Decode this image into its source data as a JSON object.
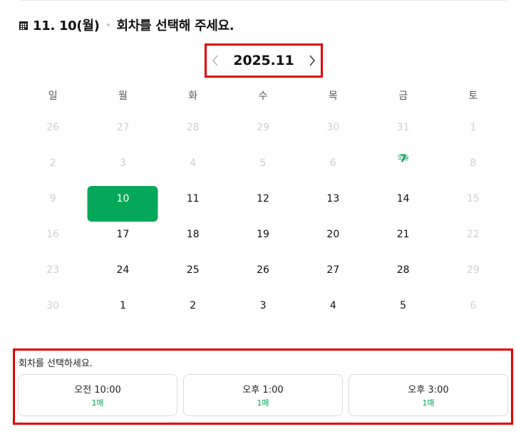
{
  "header": {
    "date": "11. 10(월)",
    "message": "회차를 선택해 주세요."
  },
  "calendar": {
    "month_label": "2025.11",
    "weekdays": [
      "일",
      "월",
      "화",
      "수",
      "목",
      "금",
      "토"
    ],
    "today_label": "오늘",
    "weeks": [
      [
        {
          "d": "26",
          "s": "muted"
        },
        {
          "d": "27",
          "s": "muted"
        },
        {
          "d": "28",
          "s": "muted"
        },
        {
          "d": "29",
          "s": "muted"
        },
        {
          "d": "30",
          "s": "muted"
        },
        {
          "d": "31",
          "s": "muted"
        },
        {
          "d": "1",
          "s": "disabled"
        }
      ],
      [
        {
          "d": "2",
          "s": "disabled"
        },
        {
          "d": "3",
          "s": "disabled"
        },
        {
          "d": "4",
          "s": "disabled"
        },
        {
          "d": "5",
          "s": "disabled"
        },
        {
          "d": "6",
          "s": "disabled"
        },
        {
          "d": "7",
          "s": "today"
        },
        {
          "d": "8",
          "s": "disabled"
        }
      ],
      [
        {
          "d": "9",
          "s": "disabled"
        },
        {
          "d": "10",
          "s": "selected"
        },
        {
          "d": "11",
          "s": "active"
        },
        {
          "d": "12",
          "s": "active"
        },
        {
          "d": "13",
          "s": "active"
        },
        {
          "d": "14",
          "s": "active"
        },
        {
          "d": "15",
          "s": "disabled"
        }
      ],
      [
        {
          "d": "16",
          "s": "disabled"
        },
        {
          "d": "17",
          "s": "active"
        },
        {
          "d": "18",
          "s": "active"
        },
        {
          "d": "19",
          "s": "active"
        },
        {
          "d": "20",
          "s": "active"
        },
        {
          "d": "21",
          "s": "active"
        },
        {
          "d": "22",
          "s": "disabled"
        }
      ],
      [
        {
          "d": "23",
          "s": "disabled"
        },
        {
          "d": "24",
          "s": "active"
        },
        {
          "d": "25",
          "s": "active"
        },
        {
          "d": "26",
          "s": "active"
        },
        {
          "d": "27",
          "s": "active"
        },
        {
          "d": "28",
          "s": "active"
        },
        {
          "d": "29",
          "s": "disabled"
        }
      ],
      [
        {
          "d": "30",
          "s": "disabled"
        },
        {
          "d": "1",
          "s": "active"
        },
        {
          "d": "2",
          "s": "active"
        },
        {
          "d": "3",
          "s": "active"
        },
        {
          "d": "4",
          "s": "active"
        },
        {
          "d": "5",
          "s": "active"
        },
        {
          "d": "6",
          "s": "disabled"
        }
      ]
    ]
  },
  "sessions": {
    "title": "회차를 선택하세요.",
    "items": [
      {
        "time": "오전 10:00",
        "remaining": "1매"
      },
      {
        "time": "오후 1:00",
        "remaining": "1매"
      },
      {
        "time": "오후 3:00",
        "remaining": "1매"
      }
    ]
  },
  "colors": {
    "accent_green": "#04a858",
    "highlight_red": "#e00000"
  }
}
